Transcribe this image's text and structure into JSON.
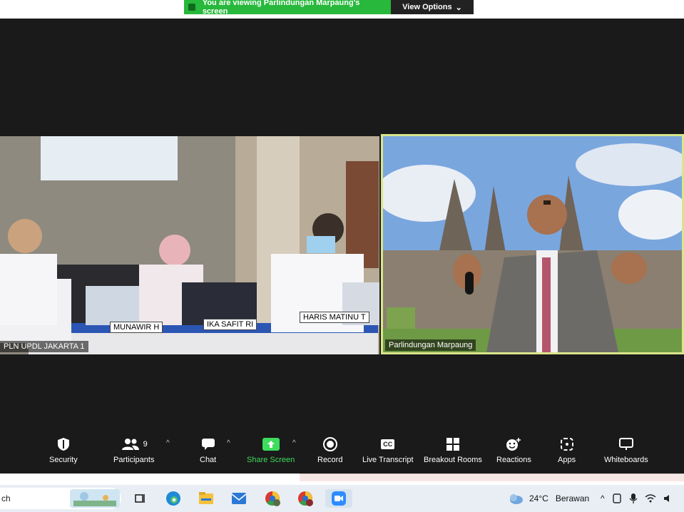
{
  "banner": {
    "viewing_text": "You are viewing Parlindungan Marpaung's screen",
    "view_options": "View Options",
    "caret": "⌄"
  },
  "tiles": {
    "left": {
      "name": "PLN UPDL JAKARTA 1",
      "placards": [
        "MUNAWIR H",
        "IKA SAFIT RI",
        "HARIS MATINU T"
      ]
    },
    "right": {
      "name": "Parlindungan Marpaung"
    }
  },
  "toolbar": {
    "security": "Security",
    "participants": "Participants",
    "participants_count": "9",
    "chat": "Chat",
    "share": "Share Screen",
    "record": "Record",
    "transcript": "Live Transcript",
    "transcript_badge": "CC",
    "breakout": "Breakout Rooms",
    "reactions": "Reactions",
    "apps": "Apps",
    "whiteboards": "Whiteboards",
    "caret": "^"
  },
  "taskbar": {
    "search_text": "ch",
    "weather_temp": "24°C",
    "weather_desc": "Berawan",
    "tray_caret": "^"
  },
  "colors": {
    "accent_green": "#27b83c",
    "share_green": "#3ddc5c",
    "active_border": "#d9e58a"
  }
}
